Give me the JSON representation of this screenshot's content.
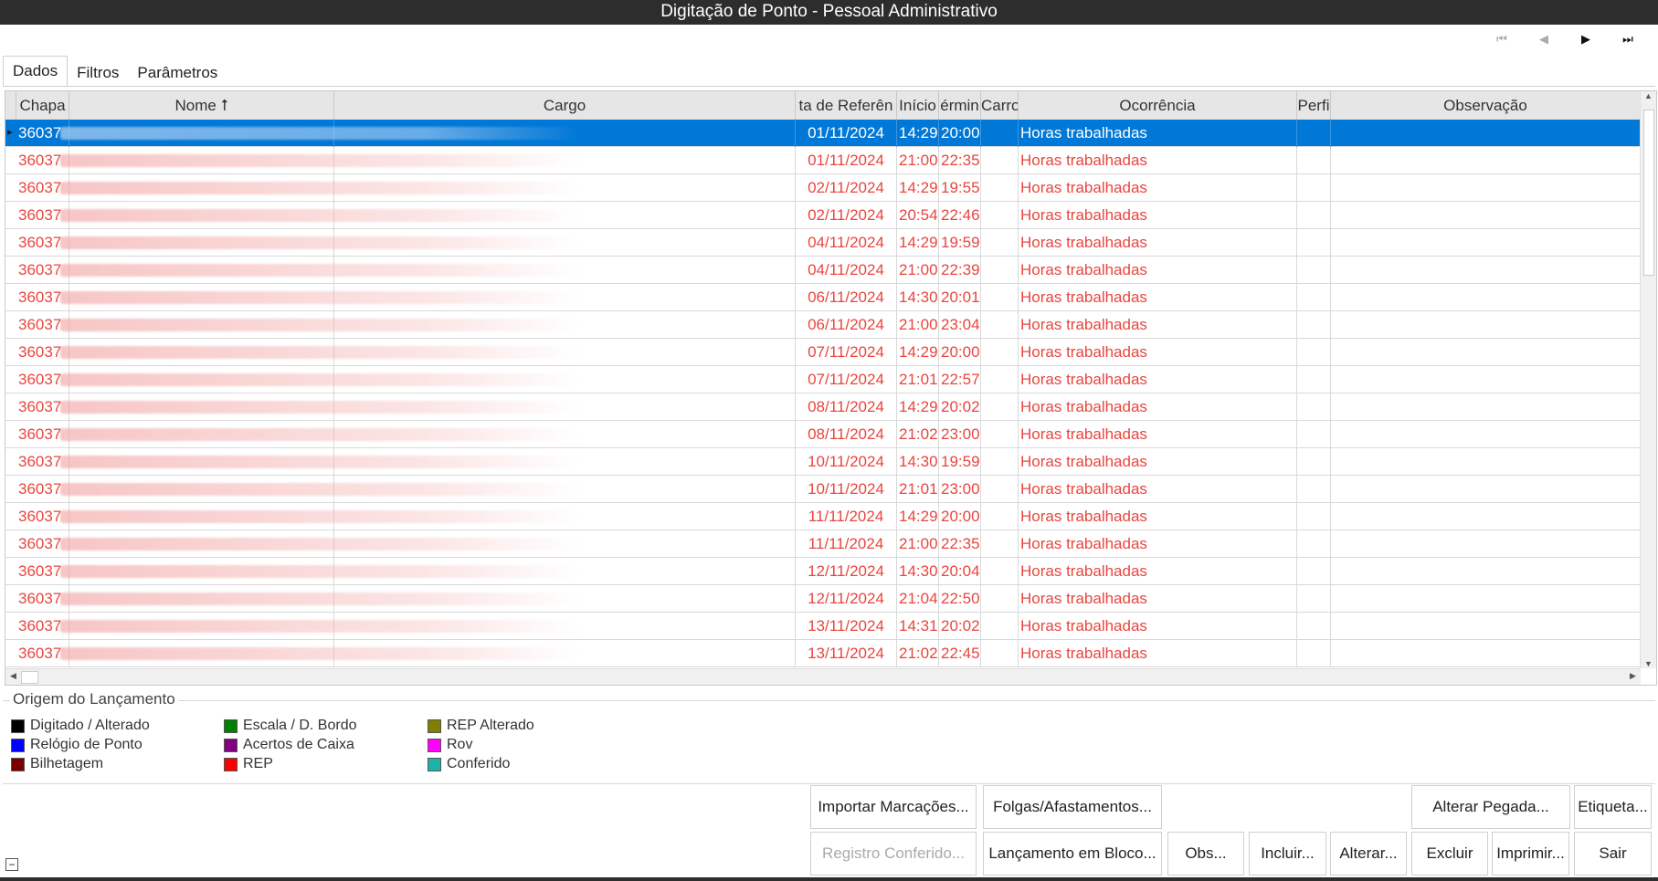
{
  "window": {
    "title": "Digitação de Ponto - Pessoal Administrativo"
  },
  "nav": {
    "first_icon": "⏮",
    "prev_icon": "◀",
    "next_icon": "▶",
    "last_icon": "⏭"
  },
  "tabs": [
    {
      "label": "Dados",
      "active": true
    },
    {
      "label": "Filtros",
      "active": false
    },
    {
      "label": "Parâmetros",
      "active": false
    }
  ],
  "grid": {
    "columns": {
      "chapa": "Chapa",
      "nome": "Nome ⭡",
      "cargo": "Cargo",
      "data_referencia": "ta de Referên",
      "inicio": "Início",
      "termino": "érmin",
      "carro": "Carro",
      "ocorrencia": "Ocorrência",
      "perfil": "Perfi",
      "observacao": "Observação"
    },
    "rows": [
      {
        "chapa": "36037",
        "data": "01/11/2024",
        "inicio": "14:29",
        "termino": "20:00",
        "ocorrencia": "Horas trabalhadas",
        "selected": true
      },
      {
        "chapa": "36037",
        "data": "01/11/2024",
        "inicio": "21:00",
        "termino": "22:35",
        "ocorrencia": "Horas trabalhadas"
      },
      {
        "chapa": "36037",
        "data": "02/11/2024",
        "inicio": "14:29",
        "termino": "19:55",
        "ocorrencia": "Horas trabalhadas"
      },
      {
        "chapa": "36037",
        "data": "02/11/2024",
        "inicio": "20:54",
        "termino": "22:46",
        "ocorrencia": "Horas trabalhadas"
      },
      {
        "chapa": "36037",
        "data": "04/11/2024",
        "inicio": "14:29",
        "termino": "19:59",
        "ocorrencia": "Horas trabalhadas"
      },
      {
        "chapa": "36037",
        "data": "04/11/2024",
        "inicio": "21:00",
        "termino": "22:39",
        "ocorrencia": "Horas trabalhadas"
      },
      {
        "chapa": "36037",
        "data": "06/11/2024",
        "inicio": "14:30",
        "termino": "20:01",
        "ocorrencia": "Horas trabalhadas"
      },
      {
        "chapa": "36037",
        "data": "06/11/2024",
        "inicio": "21:00",
        "termino": "23:04",
        "ocorrencia": "Horas trabalhadas"
      },
      {
        "chapa": "36037",
        "data": "07/11/2024",
        "inicio": "14:29",
        "termino": "20:00",
        "ocorrencia": "Horas trabalhadas"
      },
      {
        "chapa": "36037",
        "data": "07/11/2024",
        "inicio": "21:01",
        "termino": "22:57",
        "ocorrencia": "Horas trabalhadas"
      },
      {
        "chapa": "36037",
        "data": "08/11/2024",
        "inicio": "14:29",
        "termino": "20:02",
        "ocorrencia": "Horas trabalhadas"
      },
      {
        "chapa": "36037",
        "data": "08/11/2024",
        "inicio": "21:02",
        "termino": "23:00",
        "ocorrencia": "Horas trabalhadas"
      },
      {
        "chapa": "36037",
        "data": "10/11/2024",
        "inicio": "14:30",
        "termino": "19:59",
        "ocorrencia": "Horas trabalhadas"
      },
      {
        "chapa": "36037",
        "data": "10/11/2024",
        "inicio": "21:01",
        "termino": "23:00",
        "ocorrencia": "Horas trabalhadas"
      },
      {
        "chapa": "36037",
        "data": "11/11/2024",
        "inicio": "14:29",
        "termino": "20:00",
        "ocorrencia": "Horas trabalhadas"
      },
      {
        "chapa": "36037",
        "data": "11/11/2024",
        "inicio": "21:00",
        "termino": "22:35",
        "ocorrencia": "Horas trabalhadas"
      },
      {
        "chapa": "36037",
        "data": "12/11/2024",
        "inicio": "14:30",
        "termino": "20:04",
        "ocorrencia": "Horas trabalhadas"
      },
      {
        "chapa": "36037",
        "data": "12/11/2024",
        "inicio": "21:04",
        "termino": "22:50",
        "ocorrencia": "Horas trabalhadas"
      },
      {
        "chapa": "36037",
        "data": "13/11/2024",
        "inicio": "14:31",
        "termino": "20:02",
        "ocorrencia": "Horas trabalhadas"
      },
      {
        "chapa": "36037",
        "data": "13/11/2024",
        "inicio": "21:02",
        "termino": "22:45",
        "ocorrencia": "Horas trabalhadas"
      }
    ]
  },
  "legend": {
    "title": "Origem do Lançamento",
    "items": [
      {
        "label": "Digitado / Alterado",
        "color": "#000000"
      },
      {
        "label": "Relógio de Ponto",
        "color": "#0000ff"
      },
      {
        "label": "Bilhetagem",
        "color": "#7a0000"
      },
      {
        "label": "Escala / D. Bordo",
        "color": "#008000"
      },
      {
        "label": "Acertos de Caixa",
        "color": "#800080"
      },
      {
        "label": "REP",
        "color": "#ff0000"
      },
      {
        "label": "REP Alterado",
        "color": "#808000"
      },
      {
        "label": "Rov",
        "color": "#ff00ff"
      },
      {
        "label": "Conferido",
        "color": "#20b2aa"
      }
    ]
  },
  "buttons": {
    "importar": "Importar Marcações...",
    "folgas": "Folgas/Afastamentos...",
    "alterar_pegada": "Alterar Pegada...",
    "etiqueta": "Etiqueta...",
    "registro_conferido": "Registro Conferido...",
    "lancamento_bloco": "Lançamento em Bloco...",
    "obs": "Obs...",
    "incluir": "Incluir...",
    "alterar": "Alterar...",
    "excluir": "Excluir",
    "imprimir": "Imprimir...",
    "sair": "Sair"
  },
  "collapse_label": "−",
  "colors": {
    "accent": "#0078d7",
    "row_text": "#e8463f",
    "titlebar": "#2d2d2d"
  }
}
